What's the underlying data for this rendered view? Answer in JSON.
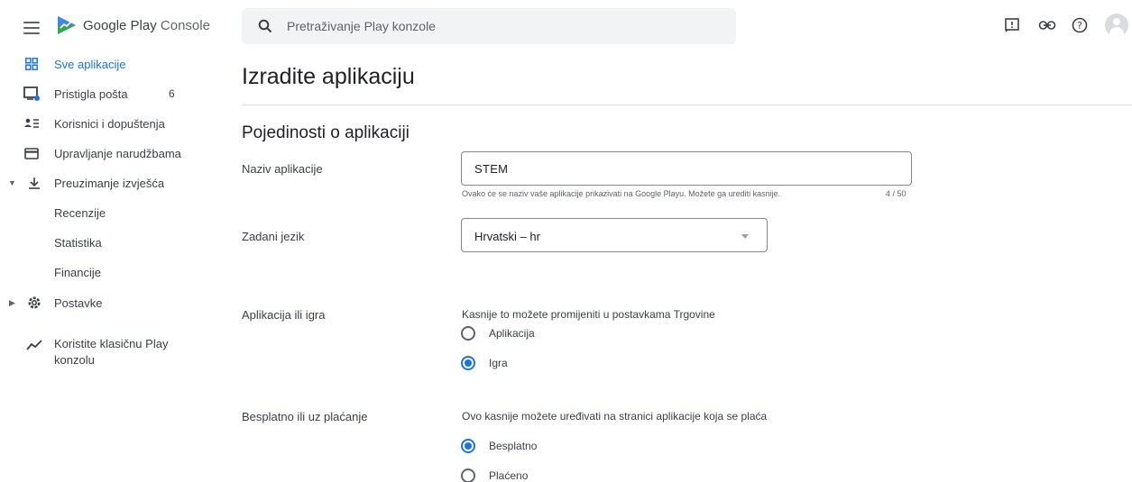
{
  "header": {
    "brand_main": "Google Play",
    "brand_sub": "Console",
    "search_placeholder": "Pretraživanje Play konzole",
    "icons": [
      "menu-icon",
      "play-console-logo",
      "search-icon",
      "feedback-icon",
      "link-icon",
      "help-icon",
      "account-avatar"
    ]
  },
  "sidebar": {
    "items": [
      {
        "label": "Sve aplikacije",
        "icon": "apps-grid-icon",
        "active": true
      },
      {
        "label": "Pristigla pošta",
        "icon": "inbox-icon",
        "badge": "6"
      },
      {
        "label": "Korisnici i dopuštenja",
        "icon": "users-icon"
      },
      {
        "label": "Upravljanje narudžbama",
        "icon": "card-icon"
      },
      {
        "label": "Preuzimanje izvješća",
        "icon": "download-icon",
        "expanded": true
      },
      {
        "label": "Recenzije"
      },
      {
        "label": "Statistika"
      },
      {
        "label": "Financije"
      },
      {
        "label": "Postavke",
        "icon": "gear-icon",
        "collapsed": true
      },
      {
        "label_line1": "Koristite klasičnu Play",
        "label_line2": "konzolu",
        "icon": "trend-icon"
      }
    ]
  },
  "main": {
    "page_title": "Izradite aplikaciju",
    "section_title": "Pojedinosti o aplikaciji",
    "app_name": {
      "label": "Naziv aplikacije",
      "value": "STEM",
      "hint": "Ovako će se naziv vaše aplikacije prikazivati na Google Playu. Možete ga urediti kasnije.",
      "counter": "4 / 50"
    },
    "default_language": {
      "label": "Zadani jezik",
      "value": "Hrvatski – hr"
    },
    "app_or_game": {
      "label": "Aplikacija ili igra",
      "description": "Kasnije to možete promijeniti u postavkama Trgovine",
      "options": [
        {
          "label": "Aplikacija",
          "checked": false
        },
        {
          "label": "Igra",
          "checked": true
        }
      ]
    },
    "free_or_paid": {
      "label": "Besplatno ili uz plaćanje",
      "description": "Ovo kasnije možete uređivati na stranici aplikacije koja se plaća",
      "options": [
        {
          "label": "Besplatno",
          "checked": true
        },
        {
          "label": "Plaćeno",
          "checked": false
        }
      ]
    }
  },
  "colors": {
    "accent": "#1a73e8",
    "text": "#3c4043",
    "muted": "#5f6368",
    "search_bg": "#f1f3f4"
  }
}
